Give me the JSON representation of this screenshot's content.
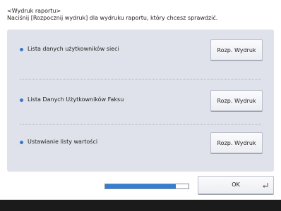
{
  "header": {
    "title": "<Wydruk raportu>",
    "instruction": "Naciśnij [Rozpocznij wydruk] dla wydruku raportu, który chcesz sprawdzić."
  },
  "reports": [
    {
      "label": "Lista danych użytkowników sieci",
      "button": "Rozp. Wydruk"
    },
    {
      "label": "Lista Danych Użytkowników Faksu",
      "button": "Rozp. Wydruk"
    },
    {
      "label": "Ustawianie listy wartości",
      "button": "Rozp. Wydruk"
    }
  ],
  "progress": {
    "value": 0.85
  },
  "footer": {
    "ok_label": "OK"
  },
  "colors": {
    "accent": "#2f7fd6",
    "panel": "#dfe2ea",
    "bullet": "#3a76c8"
  }
}
